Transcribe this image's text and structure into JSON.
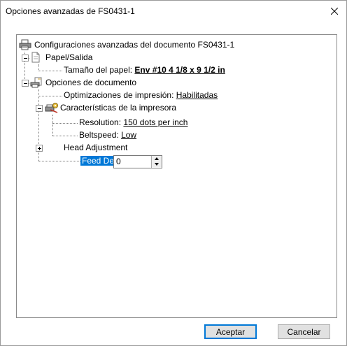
{
  "window": {
    "title": "Opciones avanzadas de FS0431-1"
  },
  "tree": {
    "root": "Configuraciones avanzadas del documento FS0431-1",
    "paper_output": {
      "label": "Papel/Salida",
      "paper_size_label": "Tamaño del papel:",
      "paper_size_value": "Env #10 4 1/8 x 9 1/2 in"
    },
    "doc_options": {
      "label": "Opciones de documento",
      "print_opt_label": "Optimizaciones de impresión:",
      "print_opt_value": "Habilitadas",
      "printer_features": {
        "label": "Características de la impresora",
        "resolution_label": "Resolution:",
        "resolution_value": "150 dots per inch",
        "beltspeed_label": "Beltspeed:",
        "beltspeed_value": "Low"
      },
      "head_adjustment": "Head Adjustment",
      "feed_delay_label": "Feed Delay:",
      "feed_delay_value": "0"
    }
  },
  "buttons": {
    "ok": "Aceptar",
    "cancel": "Cancelar"
  },
  "icons": {
    "close": "close-icon",
    "printer": "printer-icon",
    "paper": "paper-icon",
    "document_options": "document-options-icon",
    "printer_features": "printer-features-icon"
  },
  "colors": {
    "selection": "#0078d7",
    "default_button_border": "#0078d7"
  }
}
